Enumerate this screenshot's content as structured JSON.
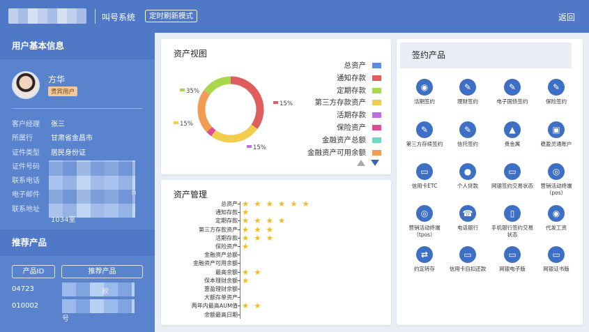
{
  "topbar": {
    "system_title": "叫号系统",
    "mode_label": "定时刷新模式",
    "back_label": "返回"
  },
  "customer": {
    "section_title": "用户基本信息",
    "name": "方华",
    "badge": "贵宾用户",
    "fields": [
      {
        "label": "客户经理",
        "value": "张三"
      },
      {
        "label": "所属行",
        "value": "甘肃省金昌市"
      },
      {
        "label": "证件类型",
        "value": "居民身份证"
      },
      {
        "label": "证件号码",
        "value": ""
      },
      {
        "label": "联系电话",
        "value": ""
      },
      {
        "label": "电子邮件",
        "value": ""
      },
      {
        "label": "联系地址",
        "value": ""
      }
    ],
    "address_tail": "1034室",
    "email_tail": "n"
  },
  "recommend": {
    "section_title": "推荐产品",
    "col_id": "产品ID",
    "col_product": "推荐产品",
    "rows": [
      {
        "id": "04723",
        "product_tail": "款"
      },
      {
        "id": "010002",
        "product_tail": "号"
      }
    ]
  },
  "asset_view": {
    "title": "资产视图"
  },
  "chart_data": [
    {
      "type": "pie",
      "title": "资产视图",
      "donut": true,
      "categories": [
        "总资产",
        "通知存款",
        "定期存款",
        "第三方存款资产",
        "活期存款",
        "保险资产",
        "金融资产总额",
        "金融资产可用余额"
      ],
      "colors": [
        "#5b8ee0",
        "#e05d5d",
        "#a9d84d",
        "#f3cd4e",
        "#c06ee0",
        "#dc4e92",
        "#6fd9c7",
        "#f29b52"
      ],
      "slice_labels": [
        "35%",
        "15%",
        "15%",
        "15%"
      ],
      "slices": [
        {
          "name": "通知存款",
          "value": 35,
          "color": "#e05d5d",
          "label": "35%"
        },
        {
          "name": "第三方存款资产",
          "value": 25,
          "color": "#f3cd4e",
          "label": "15%"
        },
        {
          "name": "保险资产",
          "value": 3,
          "color": "#dc4e92",
          "label": "15%"
        },
        {
          "name": "金融资产可用余额",
          "value": 22,
          "color": "#f29b52",
          "label": "15%"
        },
        {
          "name": "定期存款",
          "value": 15,
          "color": "#a9d84d",
          "label": ""
        }
      ],
      "legend_position": "right"
    },
    {
      "type": "bar",
      "title": "资产管理",
      "categories": [
        "总资产",
        "通知存款",
        "定期存款",
        "第三方存款资产",
        "活期存款",
        "保险资产",
        "金融资产总额",
        "金融资产可用余额",
        "最高余额",
        "保本理财余额",
        "惠盈理财余额",
        "大额存单资产",
        "两年内最高AUM值",
        "余额最高日期"
      ],
      "values": [
        6,
        1,
        4,
        3,
        3,
        1,
        0,
        0,
        2,
        1,
        0,
        0,
        2,
        0
      ],
      "value_unit": "stars"
    }
  ],
  "asset_mgmt": {
    "title": "资产管理"
  },
  "signed": {
    "title": "签约产品",
    "items": [
      {
        "label": "活期签约",
        "icon": "piggy-icon",
        "glyph": "◉"
      },
      {
        "label": "理财签约",
        "icon": "finance-icon",
        "glyph": "✎"
      },
      {
        "label": "电子国债签约",
        "icon": "bond-icon",
        "glyph": "✎"
      },
      {
        "label": "保险签约",
        "icon": "insurance-icon",
        "glyph": "✎"
      },
      {
        "label": "第三方存续签约",
        "icon": "third-party-icon",
        "glyph": "✎"
      },
      {
        "label": "信托签约",
        "icon": "trust-icon",
        "glyph": "✎"
      },
      {
        "label": "贵金属",
        "icon": "gold-icon",
        "glyph": "▲"
      },
      {
        "label": "稳盈灵通账户",
        "icon": "wallet-icon",
        "glyph": "▣"
      },
      {
        "label": "信用卡ETC",
        "icon": "credit-card-icon",
        "glyph": "▭"
      },
      {
        "label": "个人贷款",
        "icon": "personal-loan-icon",
        "glyph": "●"
      },
      {
        "label": "网银签约交易状态",
        "icon": "monitor-icon",
        "glyph": "▭"
      },
      {
        "label": "营销活动终端（pos）",
        "icon": "target-icon",
        "glyph": "◎"
      },
      {
        "label": "营销活动终端（tpos）",
        "icon": "target-icon",
        "glyph": "◎"
      },
      {
        "label": "电话银行",
        "icon": "phone-icon",
        "glyph": "☎"
      },
      {
        "label": "手机银行签约交易状态",
        "icon": "mobile-icon",
        "glyph": "▯"
      },
      {
        "label": "代发工资",
        "icon": "salary-icon",
        "glyph": "◉"
      },
      {
        "label": "约定转存",
        "icon": "transfer-icon",
        "glyph": "⇄"
      },
      {
        "label": "信用卡自扣还款",
        "icon": "card-repay-icon",
        "glyph": "▭"
      },
      {
        "label": "网银电子版",
        "icon": "monitor-icon",
        "glyph": "▭"
      },
      {
        "label": "网银证书版",
        "icon": "certificate-icon",
        "glyph": "▭"
      }
    ]
  }
}
